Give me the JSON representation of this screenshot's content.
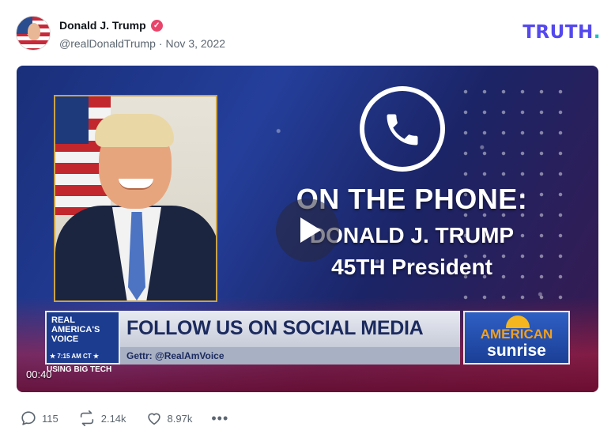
{
  "post": {
    "author_name": "Donald J. Trump",
    "verified_badge": "✓",
    "handle": "@realDonaldTrump",
    "separator": "·",
    "date": "Nov 3, 2022"
  },
  "brand": {
    "logo_text": "TRUTH",
    "logo_dot": "."
  },
  "video": {
    "headline": "ON THE PHONE:",
    "name_line": "DONALD J. TRUMP",
    "title_line": "45TH President",
    "rav_logo_text": "REAL\nAMERICA'S\nVOICE",
    "rav_time": "★ 7:15 AM CT ★",
    "banner_text": "FOLLOW US ON SOCIAL MEDIA",
    "sub_banner_text": "Gettr: @RealAmVoice",
    "show_logo_line1": "AMERICAN",
    "show_logo_line2": "sunrise",
    "ticker_text": "USING BIG TECH",
    "timestamp": "00:40"
  },
  "actions": {
    "replies": "115",
    "retruths": "2.14k",
    "likes": "8.97k",
    "more": "•••"
  },
  "colors": {
    "logo": "#5448ee",
    "logo_dot": "#17c3c3",
    "verified": "#e9456b"
  },
  "icons": [
    "verified-icon",
    "phone-icon",
    "play-icon",
    "reply-icon",
    "retruth-icon",
    "like-icon",
    "more-icon"
  ]
}
